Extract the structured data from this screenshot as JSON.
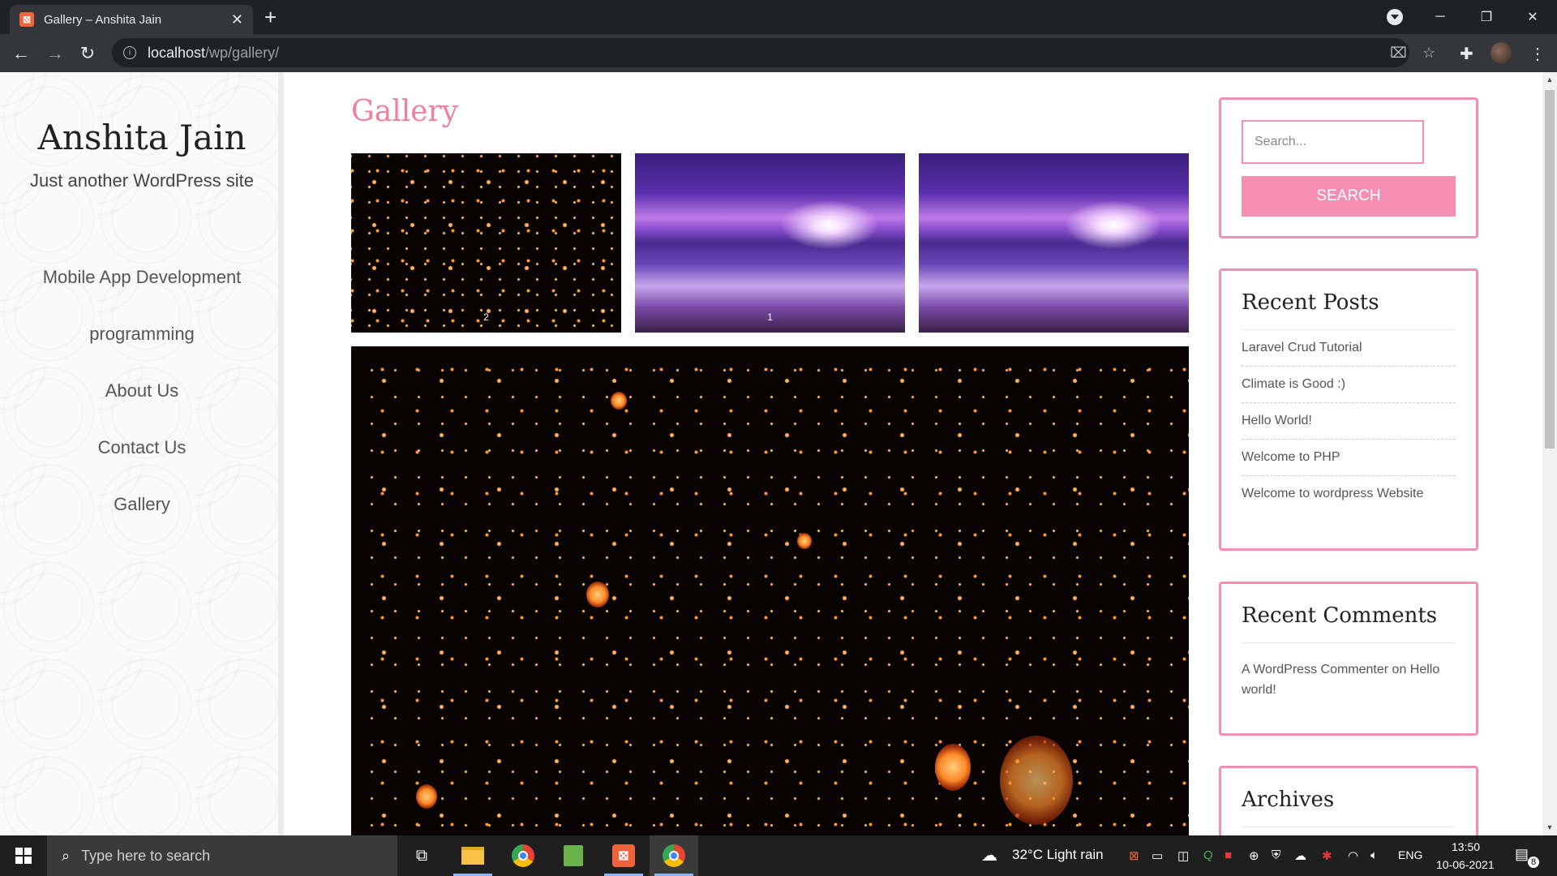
{
  "browser": {
    "tab_title": "Gallery – Anshita Jain",
    "favicon_letter": "⊠",
    "new_tab": "+",
    "url_host": "localhost",
    "url_path": "/wp/gallery/",
    "minimize": "─",
    "maximize": "❐",
    "close": "✕"
  },
  "site": {
    "title": "Anshita Jain",
    "description": "Just another WordPress site",
    "menu": [
      {
        "label": "Mobile App Development"
      },
      {
        "label": "programming"
      },
      {
        "label": "About Us"
      },
      {
        "label": "Contact Us"
      },
      {
        "label": "Gallery"
      }
    ]
  },
  "main": {
    "page_title": "Gallery",
    "thumbnails": [
      {
        "label": "2",
        "image": "lanterns"
      },
      {
        "label": "1",
        "image": "ocean-sunset"
      },
      {
        "label": "",
        "image": "ocean-sunset"
      }
    ],
    "featured_image": "lanterns"
  },
  "widgets": {
    "search": {
      "placeholder": "Search...",
      "button": "SEARCH"
    },
    "recent_posts": {
      "title": "Recent Posts",
      "items": [
        {
          "label": "Laravel Crud Tutorial"
        },
        {
          "label": "Climate is Good :)"
        },
        {
          "label": "Hello World!"
        },
        {
          "label": "Welcome to PHP"
        },
        {
          "label": "Welcome to wordpress Website"
        }
      ]
    },
    "recent_comments": {
      "title": "Recent Comments",
      "author": "A WordPress Commenter",
      "connector": " on ",
      "post": "Hello world!"
    },
    "archives": {
      "title": "Archives"
    }
  },
  "taskbar": {
    "search_placeholder": "Type here to search",
    "weather": "32°C  Light rain",
    "language": "ENG",
    "time": "13:50",
    "date": "10-06-2021",
    "notification_count": "8"
  },
  "colors": {
    "accent_pink": "#f48fb1",
    "title_pink": "#f0809e",
    "chrome_dark": "#202124"
  }
}
